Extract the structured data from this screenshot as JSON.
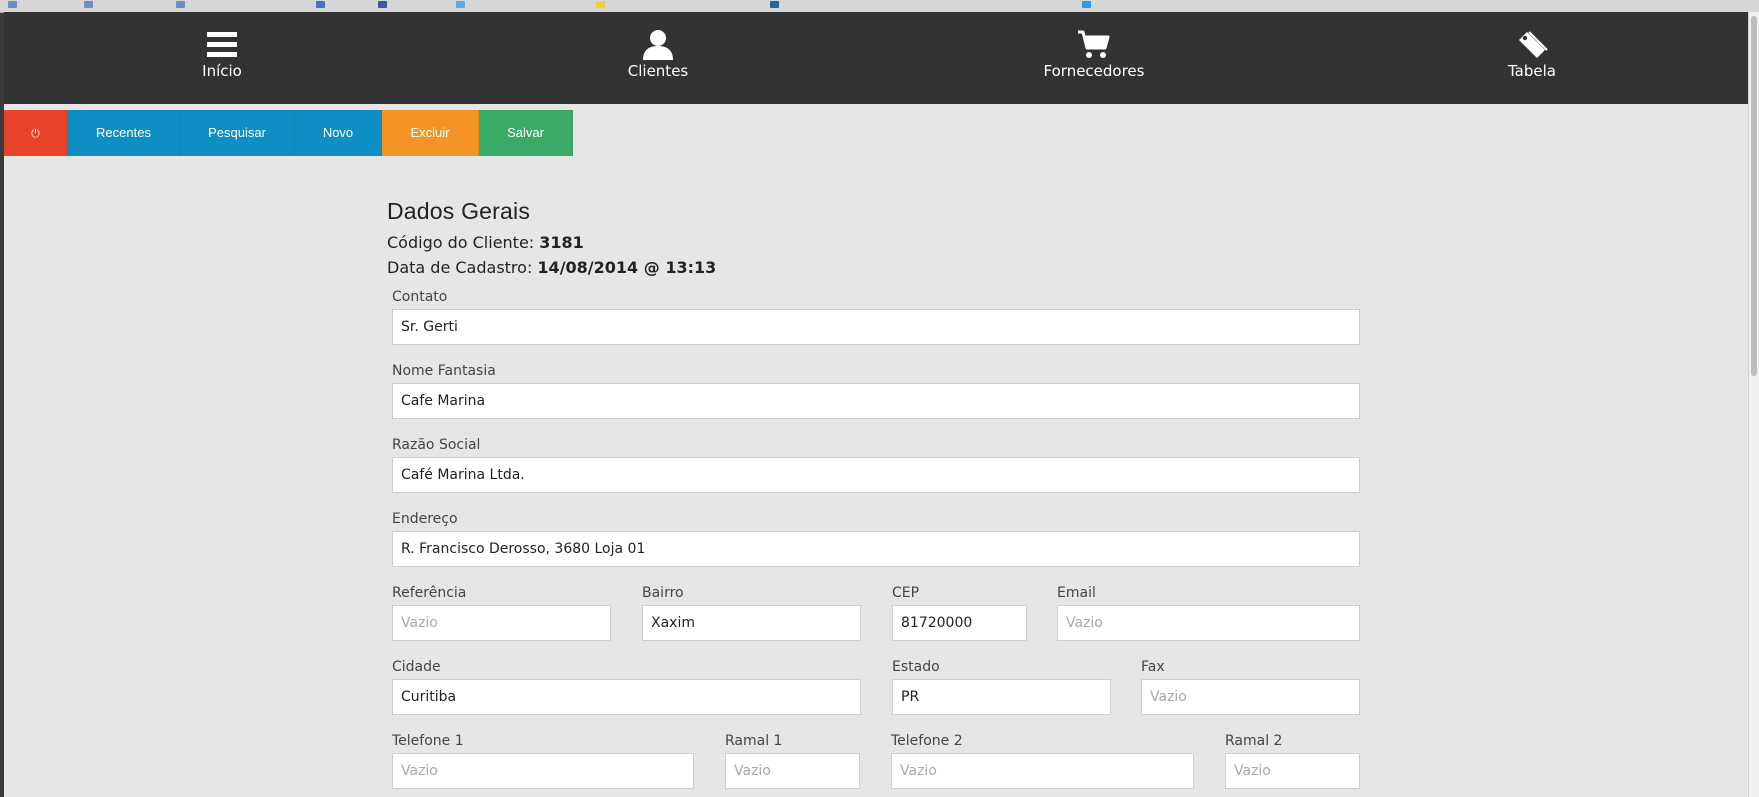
{
  "nav": {
    "items": [
      {
        "label": "Início",
        "icon": "menu-icon"
      },
      {
        "label": "Clientes",
        "icon": "user-icon"
      },
      {
        "label": "Fornecedores",
        "icon": "cart-icon"
      },
      {
        "label": "Tabela",
        "icon": "tag-icon"
      }
    ]
  },
  "toolbar": {
    "power": {
      "label": "⏻",
      "color": "#e8432b"
    },
    "recentes": {
      "label": "Recentes",
      "color": "#0e8fc3"
    },
    "pesquisar": {
      "label": "Pesquisar",
      "color": "#0e8fc3"
    },
    "novo": {
      "label": "Novo",
      "color": "#0e8fc3"
    },
    "excluir": {
      "label": "Excluir",
      "color": "#f39425"
    },
    "salvar": {
      "label": "Salvar",
      "color": "#3aaa66"
    }
  },
  "form": {
    "title": "Dados Gerais",
    "codigo_label": "Código do Cliente:",
    "codigo_value": "3181",
    "cadastro_label": "Data de Cadastro:",
    "cadastro_value": "14/08/2014 @ 13:13",
    "contato": {
      "label": "Contato",
      "value": "Sr. Gerti"
    },
    "nome_fantasia": {
      "label": "Nome Fantasia",
      "value": "Cafe Marina"
    },
    "razao_social": {
      "label": "Razão Social",
      "value": "Café Marina Ltda."
    },
    "endereco": {
      "label": "Endereço",
      "value": "R. Francisco Derosso, 3680 Loja 01"
    },
    "referencia": {
      "label": "Referência",
      "value": "",
      "placeholder": "Vazio"
    },
    "bairro": {
      "label": "Bairro",
      "value": "Xaxim"
    },
    "cep": {
      "label": "CEP",
      "value": "81720000"
    },
    "email": {
      "label": "Email",
      "value": "",
      "placeholder": "Vazio"
    },
    "cidade": {
      "label": "Cidade",
      "value": "Curitiba"
    },
    "estado": {
      "label": "Estado",
      "value": "PR"
    },
    "fax": {
      "label": "Fax",
      "value": "",
      "placeholder": "Vazio"
    },
    "telefone1": {
      "label": "Telefone 1",
      "value": "",
      "placeholder": "Vazio"
    },
    "ramal1": {
      "label": "Ramal 1",
      "value": "",
      "placeholder": "Vazio"
    },
    "telefone2": {
      "label": "Telefone 2",
      "value": "",
      "placeholder": "Vazio"
    },
    "ramal2": {
      "label": "Ramal 2",
      "value": "",
      "placeholder": "Vazio"
    }
  },
  "colors": {
    "nav_bg": "#333333",
    "page_bg": "#e6e6e6"
  }
}
